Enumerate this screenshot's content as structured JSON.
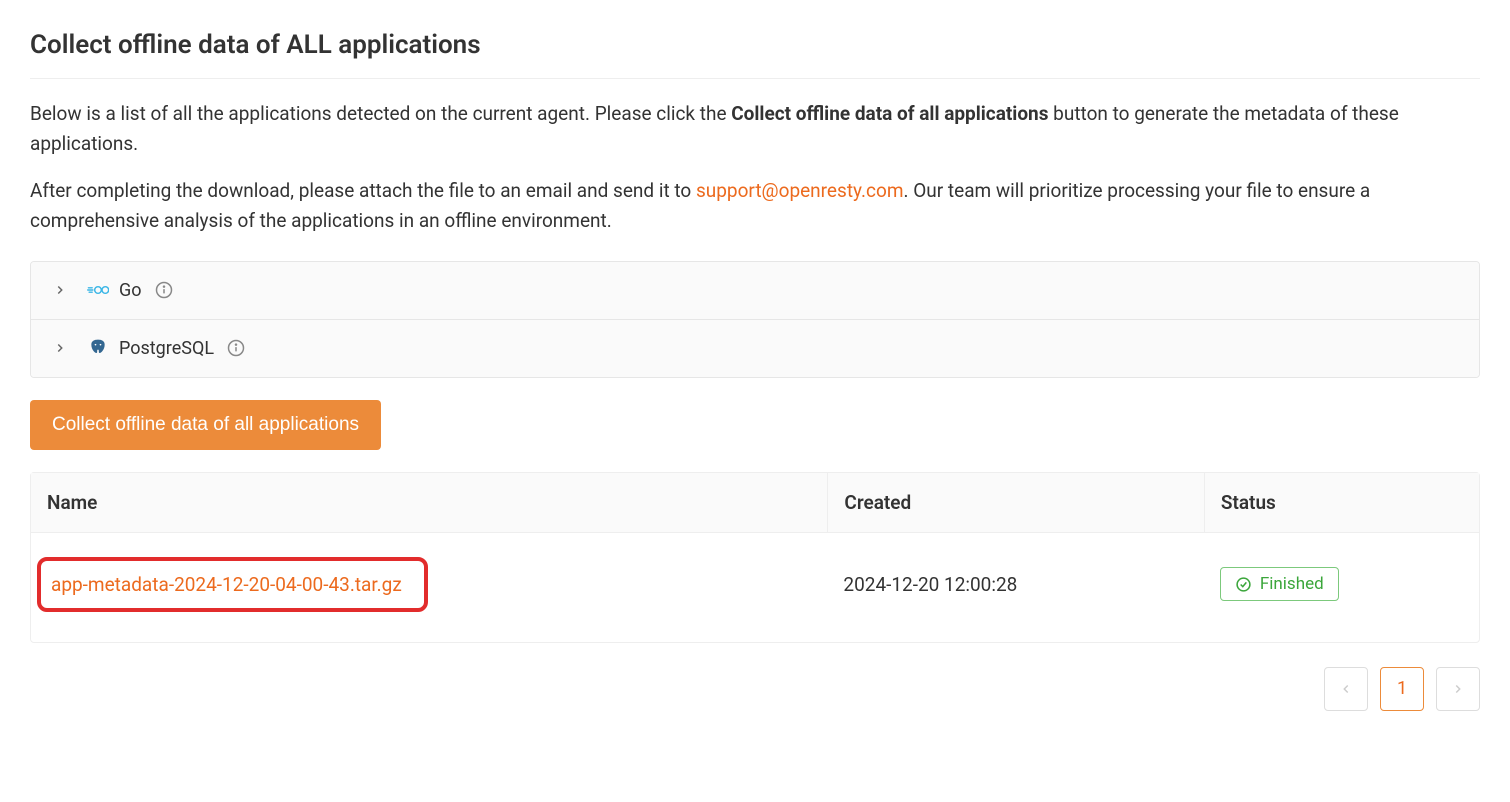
{
  "title": "Collect offline data of ALL applications",
  "description": {
    "p1_pre": "Below is a list of all the applications detected on the current agent. Please click the ",
    "p1_bold": "Collect offline data of all applications",
    "p1_post": " button to generate the metadata of these applications.",
    "p2_pre": "After completing the download, please attach the file to an email and send it to ",
    "p2_email": "support@openresty.com",
    "p2_post": ". Our team will prioritize processing your file to ensure a comprehensive analysis of the applications in an offline environment."
  },
  "apps": [
    {
      "name": "Go",
      "icon": "go"
    },
    {
      "name": "PostgreSQL",
      "icon": "postgresql"
    }
  ],
  "collect_button_label": "Collect offline data of all applications",
  "table": {
    "headers": {
      "name": "Name",
      "created": "Created",
      "status": "Status"
    },
    "rows": [
      {
        "name": "app-metadata-2024-12-20-04-00-43.tar.gz",
        "created": "2024-12-20 12:00:28",
        "status": "Finished"
      }
    ]
  },
  "pagination": {
    "current": "1"
  }
}
